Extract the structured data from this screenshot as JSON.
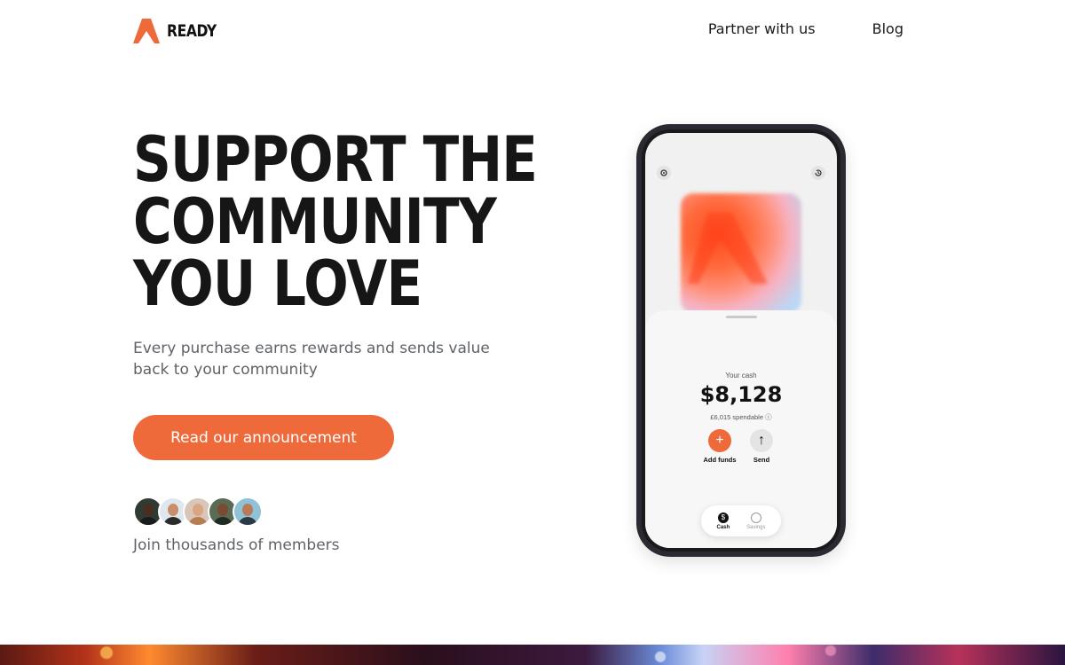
{
  "brand": {
    "name": "READY",
    "accent": "#ef6a3a"
  },
  "nav": {
    "items": [
      {
        "label": "Partner with us"
      },
      {
        "label": "Blog"
      }
    ]
  },
  "hero": {
    "title_lines": [
      "SUPPORT THE",
      "COMMUNITY",
      "YOU LOVE"
    ],
    "subtitle": "Every purchase earns rewards and sends value back to your community",
    "cta_label": "Read our announcement",
    "members_text": "Join thousands of members"
  },
  "phone": {
    "cash_label": "Your cash",
    "cash_amount": "$8,128",
    "spendable": "£6,015 spendable ⓘ",
    "actions": [
      {
        "label": "Add funds",
        "icon": "plus-icon"
      },
      {
        "label": "Send",
        "icon": "arrow-up-icon"
      }
    ],
    "tabs": [
      {
        "label": "Cash",
        "icon": "dollar-icon"
      },
      {
        "label": "Savings",
        "icon": "piggy-bank-icon"
      }
    ]
  }
}
